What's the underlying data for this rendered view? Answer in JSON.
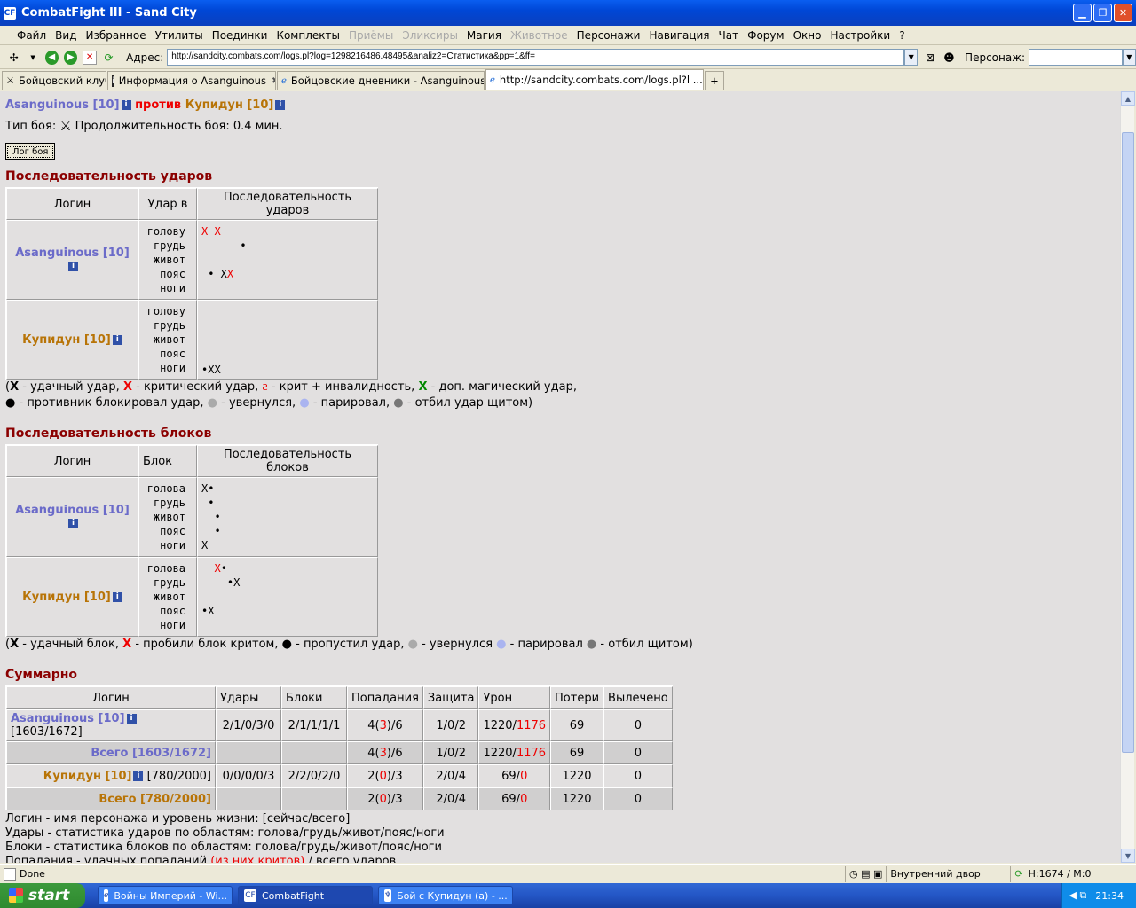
{
  "window": {
    "title": "CombatFight III - Sand City",
    "icon": "cf-app-icon"
  },
  "menu": [
    {
      "label": "Файл",
      "disabled": false
    },
    {
      "label": "Вид",
      "disabled": false
    },
    {
      "label": "Избранное",
      "disabled": false
    },
    {
      "label": "Утилиты",
      "disabled": false
    },
    {
      "label": "Поединки",
      "disabled": false
    },
    {
      "label": "Комплекты",
      "disabled": false
    },
    {
      "label": "Приёмы",
      "disabled": true
    },
    {
      "label": "Эликсиры",
      "disabled": true
    },
    {
      "label": "Магия",
      "disabled": false
    },
    {
      "label": "Животное",
      "disabled": true
    },
    {
      "label": "Персонажи",
      "disabled": false
    },
    {
      "label": "Навигация",
      "disabled": false
    },
    {
      "label": "Чат",
      "disabled": false
    },
    {
      "label": "Форум",
      "disabled": false
    },
    {
      "label": "Окно",
      "disabled": false
    },
    {
      "label": "Настройки",
      "disabled": false
    },
    {
      "label": "?",
      "disabled": false
    }
  ],
  "address": {
    "label": "Адрес:",
    "value": "http://sandcity.combats.com/logs.pl?log=1298216486.48495&analiz2=Статистика&pp=1&ff=",
    "person_label": "Персонаж:"
  },
  "tabs": [
    {
      "label": "Бойцовский клуб",
      "active": false
    },
    {
      "label": "Информация о Asanguinous",
      "active": false
    },
    {
      "label": "Бойцовские дневники - Asanguinous",
      "active": false
    },
    {
      "label": "http://sandcity.combats.com/logs.pl?l ...",
      "active": true
    }
  ],
  "page": {
    "p1": "Asanguinous [10]",
    "vs": "против",
    "p2": "Купидун [10]",
    "fight_type_label": "Тип боя:",
    "duration": "Продолжительность боя: 0.4 мин.",
    "log_button": "Лог боя",
    "hits": {
      "title": "Последовательность ударов",
      "h_login": "Логин",
      "h_target": "Удар в",
      "h_seq": "Последовательность ударов",
      "areas": [
        "голову",
        "грудь",
        "живот",
        "пояс",
        "ноги"
      ],
      "p1_seq": [
        [
          "X X",
          ""
        ],
        [
          "",
          ""
        ],
        [
          "",
          "      •"
        ],
        [
          "",
          ""
        ],
        [
          "  • X",
          "X"
        ],
        [
          "",
          ""
        ]
      ],
      "p2_seq": [
        "",
        "",
        "",
        "",
        "•XX"
      ]
    },
    "hits_legend": {
      "l1": "удачный удар,",
      "l2": "критический удар,",
      "l3": "крит + инвалидность,",
      "l4": "доп. магический удар,",
      "l5": "противник блокировал удар,",
      "l6": "увернулся,",
      "l7": "парировал,",
      "l8": "отбил удар щитом)"
    },
    "blocks": {
      "title": "Последовательность блоков",
      "h_login": "Логин",
      "h_block": "Блок",
      "h_seq": "Последовательность блоков",
      "areas": [
        "голова",
        "грудь",
        "живот",
        "пояс",
        "ноги"
      ]
    },
    "blocks_legend": {
      "l1": "удачный блок,",
      "l2": "пробили блок критом,",
      "l3": "пропустил удар,",
      "l4": "увернулся",
      "l5": "парировал",
      "l6": "отбил щитом)"
    },
    "summary": {
      "title": "Суммарно",
      "headers": [
        "Логин",
        "Удары",
        "Блоки",
        "Попадания",
        "Защита",
        "Урон",
        "Потери",
        "Вылечено"
      ],
      "row1": {
        "name": "Asanguinous [10]",
        "hp": "[1603/1672]",
        "hits": "2/1/0/3/0",
        "blocks": "2/1/1/1/1",
        "hits_a": "4(",
        "hits_b": "3",
        ")/6": "",
        "hits_c": ")/6",
        "prot": "1/0/2",
        "dmg_a": "1220/",
        "dmg_b": "1176",
        "loss": "69",
        "heal": "0"
      },
      "row2": {
        "name": "Всего [1603/1672]",
        "hits_a": "4(",
        "hits_b": "3",
        "hits_c": ")/6",
        "prot": "1/0/2",
        "dmg_a": "1220/",
        "dmg_b": "1176",
        "loss": "69",
        "heal": "0"
      },
      "row3": {
        "name": "Купидун [10]",
        "hp": "[780/2000]",
        "hits": "0/0/0/0/3",
        "blocks": "2/2/0/2/0",
        "hits_a": "2(",
        "hits_b": "0",
        "hits_c": ")/3",
        "prot": "2/0/4",
        "dmg_a": "69/",
        "dmg_b": "0",
        "loss": "1220",
        "heal": "0"
      },
      "row4": {
        "name": "Всего [780/2000]",
        "hits_a": "2(",
        "hits_b": "0",
        "hits_c": ")/3",
        "prot": "2/0/4",
        "dmg_a": "69/",
        "dmg_b": "0",
        "loss": "1220",
        "heal": "0"
      }
    },
    "notes": {
      "n1": "Логин - имя персонажа и уровень жизни: [сейчас/всего]",
      "n2": "Удары - статистика ударов по областям: голова/грудь/живот/пояс/ноги",
      "n3": "Блоки - статистика блоков по областям: голова/грудь/живот/пояс/ноги",
      "n4a": "Попадания - удачных попаданий",
      "n4b": "(из них критов)",
      "n4c": "/ всего ударов"
    }
  },
  "status": {
    "text": "Done",
    "location": "Внутренний двор",
    "hp": "H:1674 / M:0"
  },
  "taskbar": {
    "start": "start",
    "t1": "Войны Империй - Wi...",
    "t2": "CombatFight",
    "t3": "Бой с Купидун (а) - ...",
    "clock": "21:34"
  }
}
